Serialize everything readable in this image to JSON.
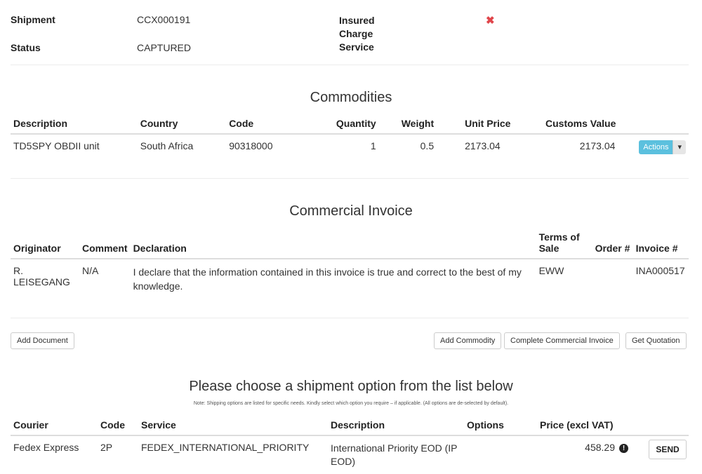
{
  "summary": {
    "shipment_label": "Shipment",
    "shipment_value": "CCX000191",
    "status_label": "Status",
    "status_value": "CAPTURED",
    "insured_label": "Insured",
    "charge_label": "Charge",
    "service_label": "Service",
    "insured_icon": "red-x-icon",
    "insured_color": "#e0454a"
  },
  "commodities": {
    "title": "Commodities",
    "headers": [
      "Description",
      "Country",
      "Code",
      "Quantity",
      "Weight",
      "Unit Price",
      "Customs Value"
    ],
    "rows": [
      {
        "description": "TD5SPY OBDII unit",
        "country": "South Africa",
        "code": "90318000",
        "quantity": "1",
        "weight": "0.5",
        "unit_price": "2173.04",
        "customs_value": "2173.04"
      }
    ],
    "actions_label": "Actions"
  },
  "invoice": {
    "title": "Commercial Invoice",
    "headers": {
      "originator": "Originator",
      "comment": "Comment",
      "declaration": "Declaration",
      "terms": "Terms of Sale",
      "order": "Order #",
      "invoice": "Invoice #"
    },
    "row": {
      "originator": "R. LEISEGANG",
      "comment": "N/A",
      "declaration": "I declare that the information contained in this invoice is true and correct to the best of my knowledge.",
      "terms": "EWW",
      "order": "",
      "invoice": "INA000517"
    }
  },
  "buttons": {
    "add_document": "Add Document",
    "add_commodity": "Add Commodity",
    "complete_invoice": "Complete Commercial Invoice",
    "get_quotation": "Get Quotation"
  },
  "shipping": {
    "title": "Please choose a shipment option from the list below",
    "note": "Note: Shipping options are listed for specific needs. Kindly select which option you require – if applicable. (All options are de-selected by default).",
    "headers": {
      "courier": "Courier",
      "code": "Code",
      "service": "Service",
      "description": "Description",
      "options": "Options",
      "price": "Price (excl VAT)"
    },
    "row": {
      "courier": "Fedex Express",
      "code": "2P",
      "service": "FEDEX_INTERNATIONAL_PRIORITY",
      "description": "International Priority EOD (IP EOD)",
      "options": "",
      "price": "458.29",
      "send_label": "SEND"
    }
  }
}
